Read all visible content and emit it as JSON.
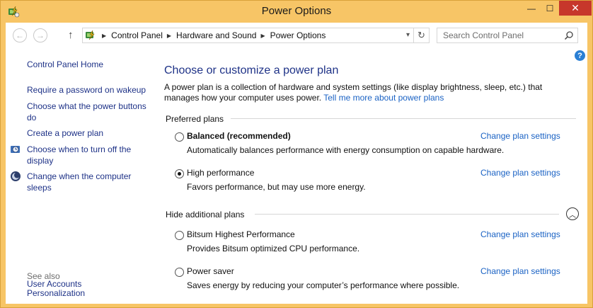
{
  "window": {
    "title": "Power Options",
    "minimize_glyph": "—",
    "maximize_glyph": "☐",
    "close_glyph": "✕"
  },
  "nav": {
    "back_glyph": "←",
    "forward_glyph": "→",
    "up_glyph": "↑",
    "dropdown_glyph": "▾",
    "refresh_glyph": "↻",
    "breadcrumbs": [
      "Control Panel",
      "Hardware and Sound",
      "Power Options"
    ],
    "separator_glyph": "▶"
  },
  "search": {
    "placeholder": "Search Control Panel"
  },
  "sidebar": {
    "home": "Control Panel Home",
    "links": [
      "Require a password on wakeup",
      "Choose what the power buttons do",
      "Create a power plan",
      "Choose when to turn off the display",
      "Change when the computer sleeps"
    ],
    "see_also_label": "See also",
    "see_also_links": [
      "Personalization",
      "User Accounts"
    ]
  },
  "main": {
    "help_glyph": "?",
    "title": "Choose or customize a power plan",
    "intro_text": "A power plan is a collection of hardware and system settings (like display brightness, sleep, etc.) that manages how your computer uses power.",
    "intro_link": "Tell me more about power plans",
    "preferred_label": "Preferred plans",
    "additional_label": "Hide additional plans",
    "collapse_glyph": "︿",
    "change_label": "Change plan settings",
    "preferred_plans": [
      {
        "name": "Balanced (recommended)",
        "desc": "Automatically balances performance with energy consumption on capable hardware.",
        "selected": false
      },
      {
        "name": "High performance",
        "desc": "Favors performance, but may use more energy.",
        "selected": true
      }
    ],
    "additional_plans": [
      {
        "name": "Bitsum Highest Performance",
        "desc": "Provides Bitsum optimized CPU performance.",
        "selected": false
      },
      {
        "name": "Power saver",
        "desc": "Saves energy by reducing your computer’s performance where possible.",
        "selected": false
      }
    ]
  },
  "colors": {
    "frame": "#f7c566",
    "close_button": "#c7372b",
    "link": "#1a62c4",
    "nav_link": "#1e3287"
  }
}
